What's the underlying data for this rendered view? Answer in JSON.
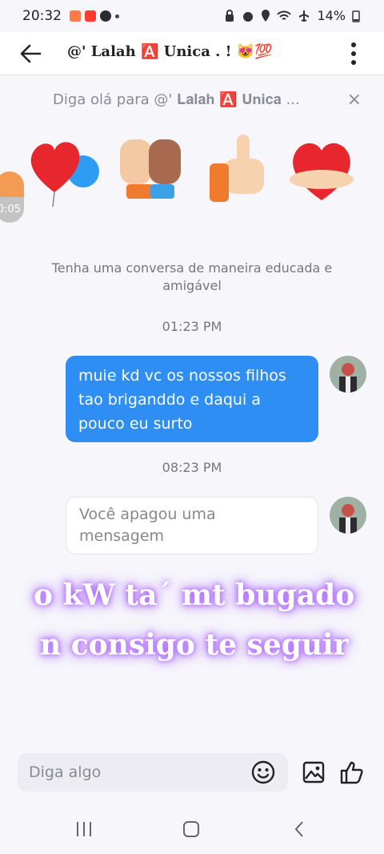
{
  "status": {
    "time": "20:32",
    "battery": "14%"
  },
  "header": {
    "title": "@' 𝐋𝐚𝐥𝐚𝐡 🅰️ 𝐔𝐧𝐢𝐜𝐚 . ! 😻💯"
  },
  "greeting": {
    "text": "Diga olá para @' 𝐋𝐚𝐥𝐚𝐡 🅰️ 𝐔𝐧𝐢𝐜𝐚 ...",
    "close": "×"
  },
  "recording": {
    "time": "0:05"
  },
  "polite_notice": "Tenha uma conversa de maneira educada e amigável",
  "messages": [
    {
      "time": "01:23 PM",
      "text": "muie kd vc os nossos filhos tao briganddo e daqui a pouco eu surto"
    },
    {
      "time": "08:23 PM",
      "text": "Você apagou uma mensagem"
    }
  ],
  "overlay": {
    "line1": "o kW ta´ mt bugado",
    "line2": "n consigo te seguir"
  },
  "composer": {
    "placeholder": "Diga algo"
  },
  "colors": {
    "accent": "#2f8ef4",
    "glow": "#a855f7"
  }
}
